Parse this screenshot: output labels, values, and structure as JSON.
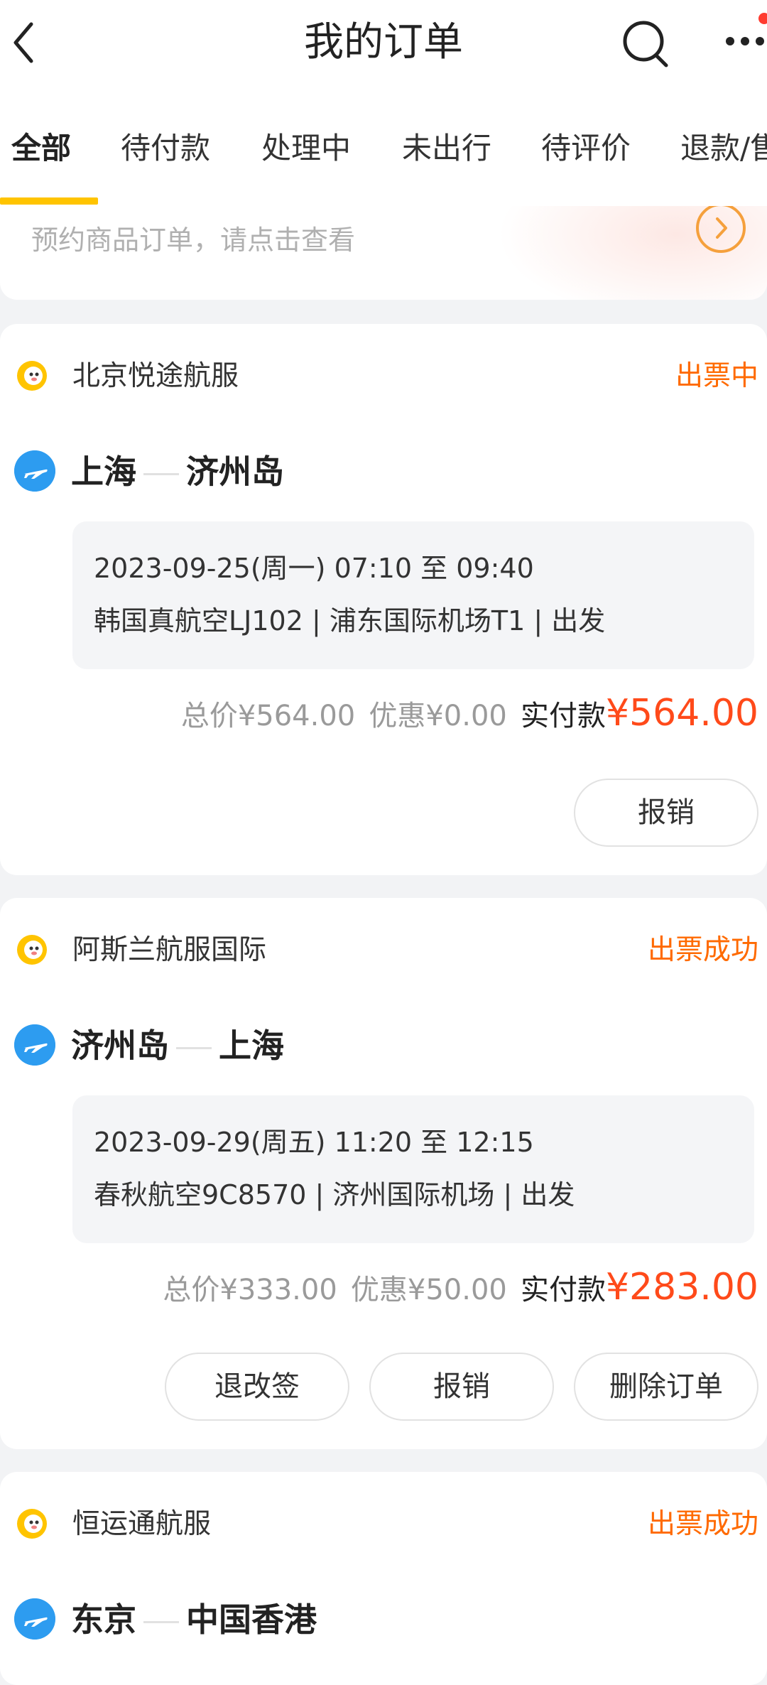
{
  "header": {
    "title": "我的订单"
  },
  "tabs": [
    "全部",
    "待付款",
    "处理中",
    "未出行",
    "待评价",
    "退款/售后"
  ],
  "promo": {
    "text": "预约商品订单，请点击查看"
  },
  "orders": [
    {
      "airline": "北京悦途航服",
      "status": "出票中",
      "from": "上海",
      "to": "济州岛",
      "line1": "2023-09-25(周一) 07:10 至 09:40",
      "line2": "韩国真航空LJ102 | 浦东国际机场T1 | 出发",
      "total": "总价¥564.00",
      "discount": "优惠¥0.00",
      "paid_label": "实付款",
      "paid": "¥564.00",
      "buttons": [
        "报销"
      ]
    },
    {
      "airline": "阿斯兰航服国际",
      "status": "出票成功",
      "from": "济州岛",
      "to": "上海",
      "line1": "2023-09-29(周五) 11:20 至 12:15",
      "line2": "春秋航空9C8570 | 济州国际机场 | 出发",
      "total": "总价¥333.00",
      "discount": "优惠¥50.00",
      "paid_label": "实付款",
      "paid": "¥283.00",
      "buttons": [
        "退改签",
        "报销",
        "删除订单"
      ]
    },
    {
      "airline": "恒运通航服",
      "status": "出票成功",
      "from": "东京",
      "to": "中国香港"
    }
  ],
  "icons": {
    "back": "chevron-left-icon",
    "search": "search-icon",
    "more": "more-dots-icon",
    "airline": "airline-logo-icon",
    "plane": "plane-icon"
  },
  "colors": {
    "accent": "#ffc400",
    "status": "#ff6a00",
    "price": "#ff4a1a",
    "plane": "#2d9cf0"
  }
}
